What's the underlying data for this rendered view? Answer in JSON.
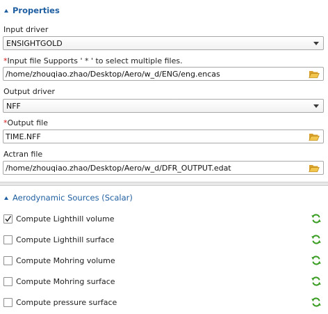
{
  "properties": {
    "title": "Properties",
    "input_driver": {
      "label": "Input driver",
      "value": "ENSIGHTGOLD"
    },
    "input_file": {
      "required_mark": "*",
      "label": "Input file Supports ' * ' to select multiple files.",
      "value": "/home/zhouqiao.zhao/Desktop/Aero/w_d/ENG/eng.encas"
    },
    "output_driver": {
      "label": "Output driver",
      "value": "NFF"
    },
    "output_file": {
      "required_mark": "*",
      "label": "Output file",
      "value": "TIME.NFF"
    },
    "actran_file": {
      "label": "Actran file",
      "value": "/home/zhouqiao.zhao/Desktop/Aero/w_d/DFR_OUTPUT.edat"
    }
  },
  "aero_sources": {
    "title": "Aerodynamic Sources (Scalar)",
    "items": [
      {
        "label": "Compute Lighthill volume",
        "checked": true
      },
      {
        "label": "Compute Lighthill surface",
        "checked": false
      },
      {
        "label": "Compute Mohring volume",
        "checked": false
      },
      {
        "label": "Compute Mohring surface",
        "checked": false
      },
      {
        "label": "Compute pressure surface",
        "checked": false
      }
    ]
  },
  "icons": {
    "collapse": "collapse-triangle-icon",
    "dropdown": "chevron-down-icon",
    "browse": "folder-open-icon",
    "reset": "refresh-icon",
    "check": "checkmark-icon"
  },
  "colors": {
    "section_title": "#1f5fa1",
    "required": "#d01818",
    "folder": "#e8b53c",
    "reset": "#3a9d23"
  }
}
